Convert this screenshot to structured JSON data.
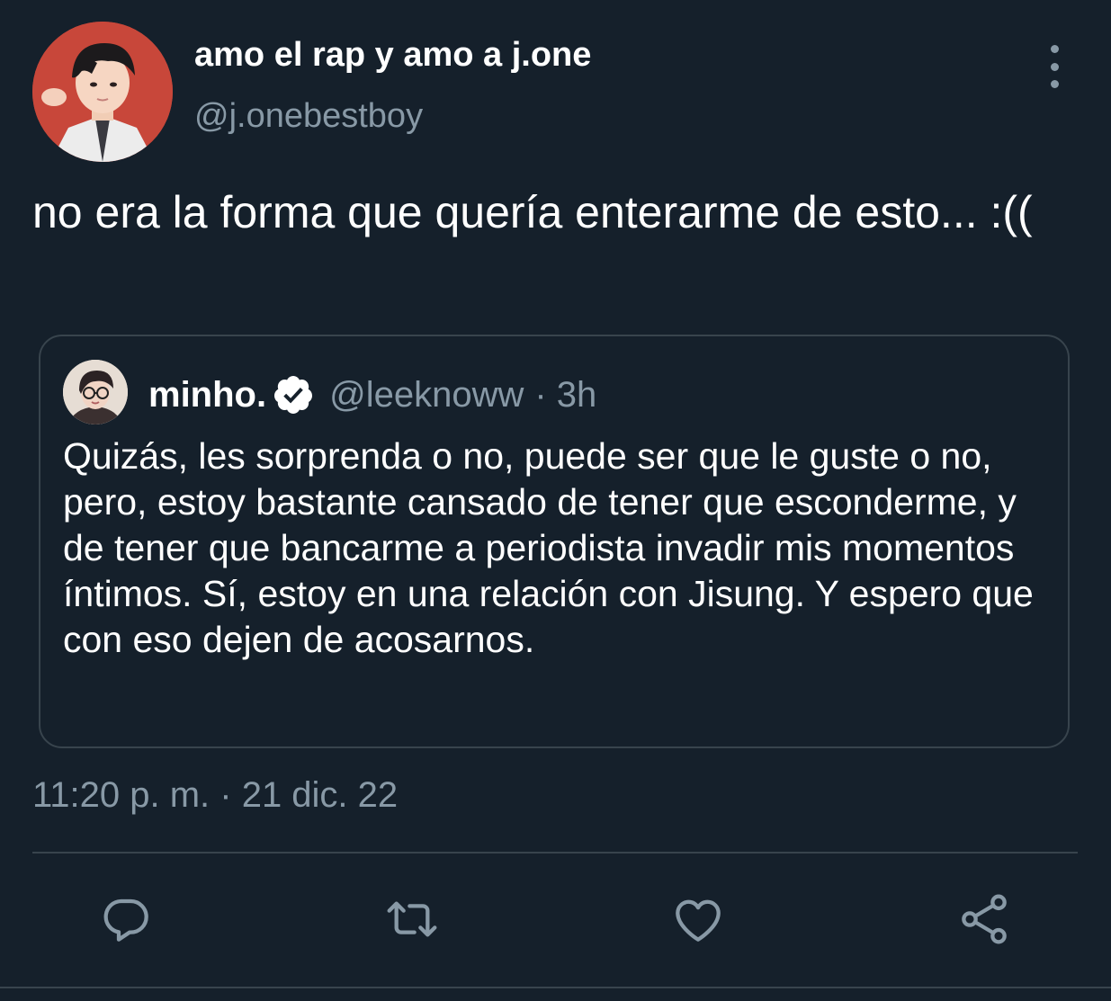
{
  "tweet": {
    "author": {
      "display_name": "amo el rap y amo a j.one",
      "handle": "@j.onebestboy"
    },
    "text": "no era la forma que quería enterarme de esto... :((",
    "timestamp": "11:20 p. m. · 21 dic. 22"
  },
  "quoted_tweet": {
    "author": {
      "display_name": "minho.",
      "handle": "@leeknoww",
      "time_ago": "· 3h"
    },
    "text": "Quizás, les sorprenda o no, puede ser que le guste o no, pero, estoy bastante cansado de tener que esconderme, y de tener que bancarme a periodista invadir mis momentos íntimos. Sí, estoy en una relación con Jisung. Y espero que con eso dejen de acosarnos."
  },
  "icons": {
    "more": "more-vertical-icon",
    "verified": "verified-badge-icon",
    "reply": "reply-icon",
    "retweet": "retweet-icon",
    "like": "heart-icon",
    "share": "share-icon"
  },
  "colors": {
    "background": "#15202b",
    "secondary_text": "#8899a6",
    "border": "#38444d"
  }
}
